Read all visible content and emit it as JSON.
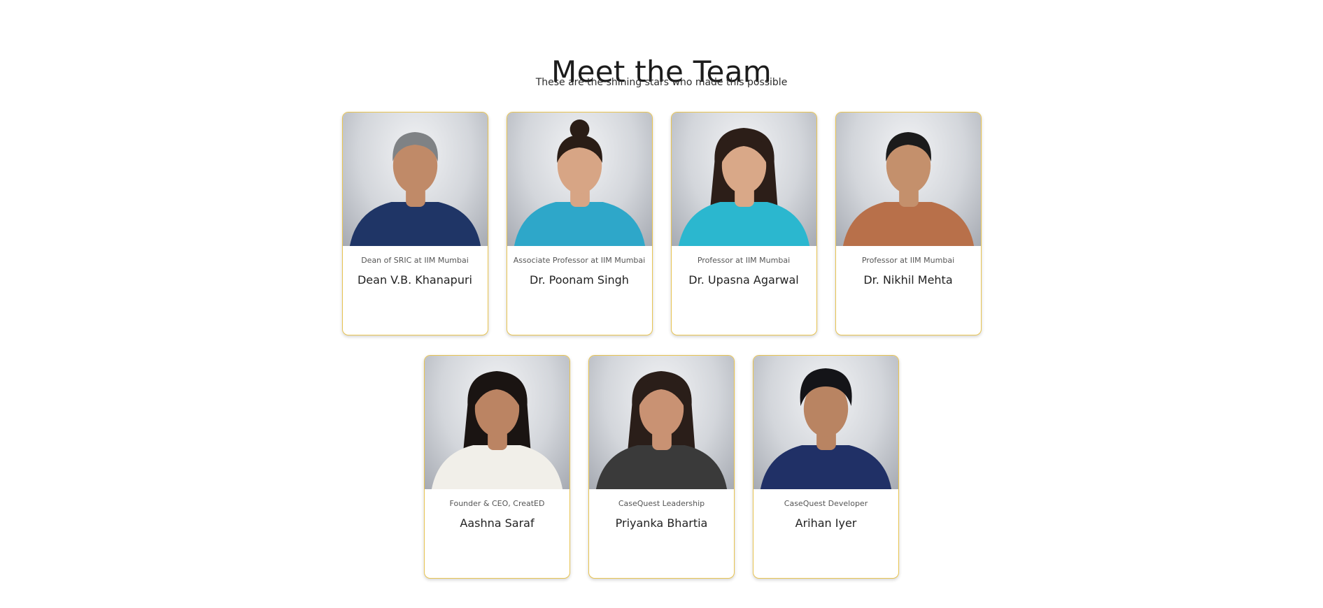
{
  "header": {
    "title": "Meet the Team",
    "subtitle": "These are the shining stars who made this possible"
  },
  "accent_color": "#e8c452",
  "team": [
    {
      "role": "Dean of SRIC at IIM Mumbai",
      "name": "Dean V.B. Khanapuri",
      "skin": "#c08a68",
      "hair": "#7f8285",
      "top": "#1f3566",
      "hair_style": "short"
    },
    {
      "role": "Associate Professor at IIM Mumbai",
      "name": "Dr. Poonam Singh",
      "skin": "#d7a585",
      "hair": "#2a1d16",
      "top": "#2ea7c9",
      "hair_style": "bun"
    },
    {
      "role": "Professor at IIM Mumbai",
      "name": "Dr. Upasna Agarwal",
      "skin": "#d9a888",
      "hair": "#2c1e18",
      "top": "#2bb7cf",
      "hair_style": "long"
    },
    {
      "role": "Professor at IIM Mumbai",
      "name": "Dr. Nikhil Mehta",
      "skin": "#c4906c",
      "hair": "#1b1b1b",
      "top": "#b8704a",
      "hair_style": "short"
    },
    {
      "role": "Founder & CEO, CreatED",
      "name": "Aashna Saraf",
      "skin": "#bb8463",
      "hair": "#1a1412",
      "top": "#f1efe9",
      "hair_style": "long"
    },
    {
      "role": "CaseQuest Leadership",
      "name": "Priyanka Bhartia",
      "skin": "#c99273",
      "hair": "#2a1e19",
      "top": "#3a3a3a",
      "hair_style": "long"
    },
    {
      "role": "CaseQuest Developer",
      "name": "Arihan Iyer",
      "skin": "#b98462",
      "hair": "#141418",
      "top": "#203066",
      "hair_style": "curly"
    }
  ]
}
